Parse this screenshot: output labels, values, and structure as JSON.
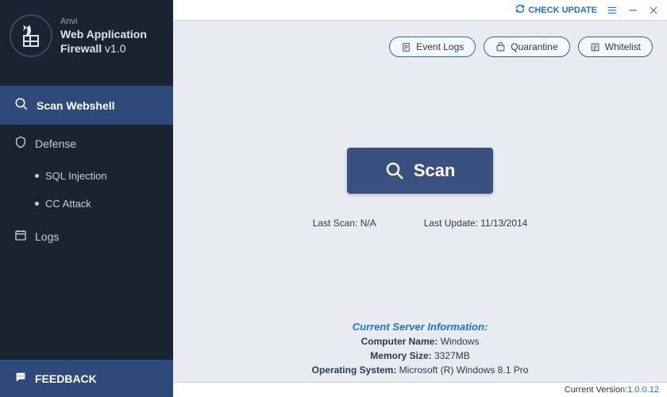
{
  "app": {
    "brand": "Anvi",
    "name": "Web Application",
    "product": "Firewall",
    "version_suffix": "v1.0"
  },
  "nav": {
    "scan_webshell": "Scan Webshell",
    "defense": "Defense",
    "sql_injection": "SQL Injection",
    "cc_attack": "CC Attack",
    "logs": "Logs"
  },
  "feedback": {
    "label": "FEEDBACK"
  },
  "topbar": {
    "check_update": "CHECK UPDATE"
  },
  "pills": {
    "event_logs": "Event Logs",
    "quarantine": "Quarantine",
    "whitelist": "Whitelist"
  },
  "scan": {
    "button": "Scan"
  },
  "meta": {
    "last_scan_label": "Last Scan:",
    "last_scan_value": "N/A",
    "last_update_label": "Last Update:",
    "last_update_value": "11/13/2014"
  },
  "server": {
    "title": "Current Server Information:",
    "computer_name_label": "Computer Name:",
    "computer_name_value": "Windows",
    "memory_label": "Memory Size:",
    "memory_value": "3327MB",
    "os_label": "Operating System:",
    "os_value": "Microsoft (R) Windows 8.1 Pro"
  },
  "footer": {
    "label": "Current Version:",
    "value": "1.0.0.12"
  }
}
